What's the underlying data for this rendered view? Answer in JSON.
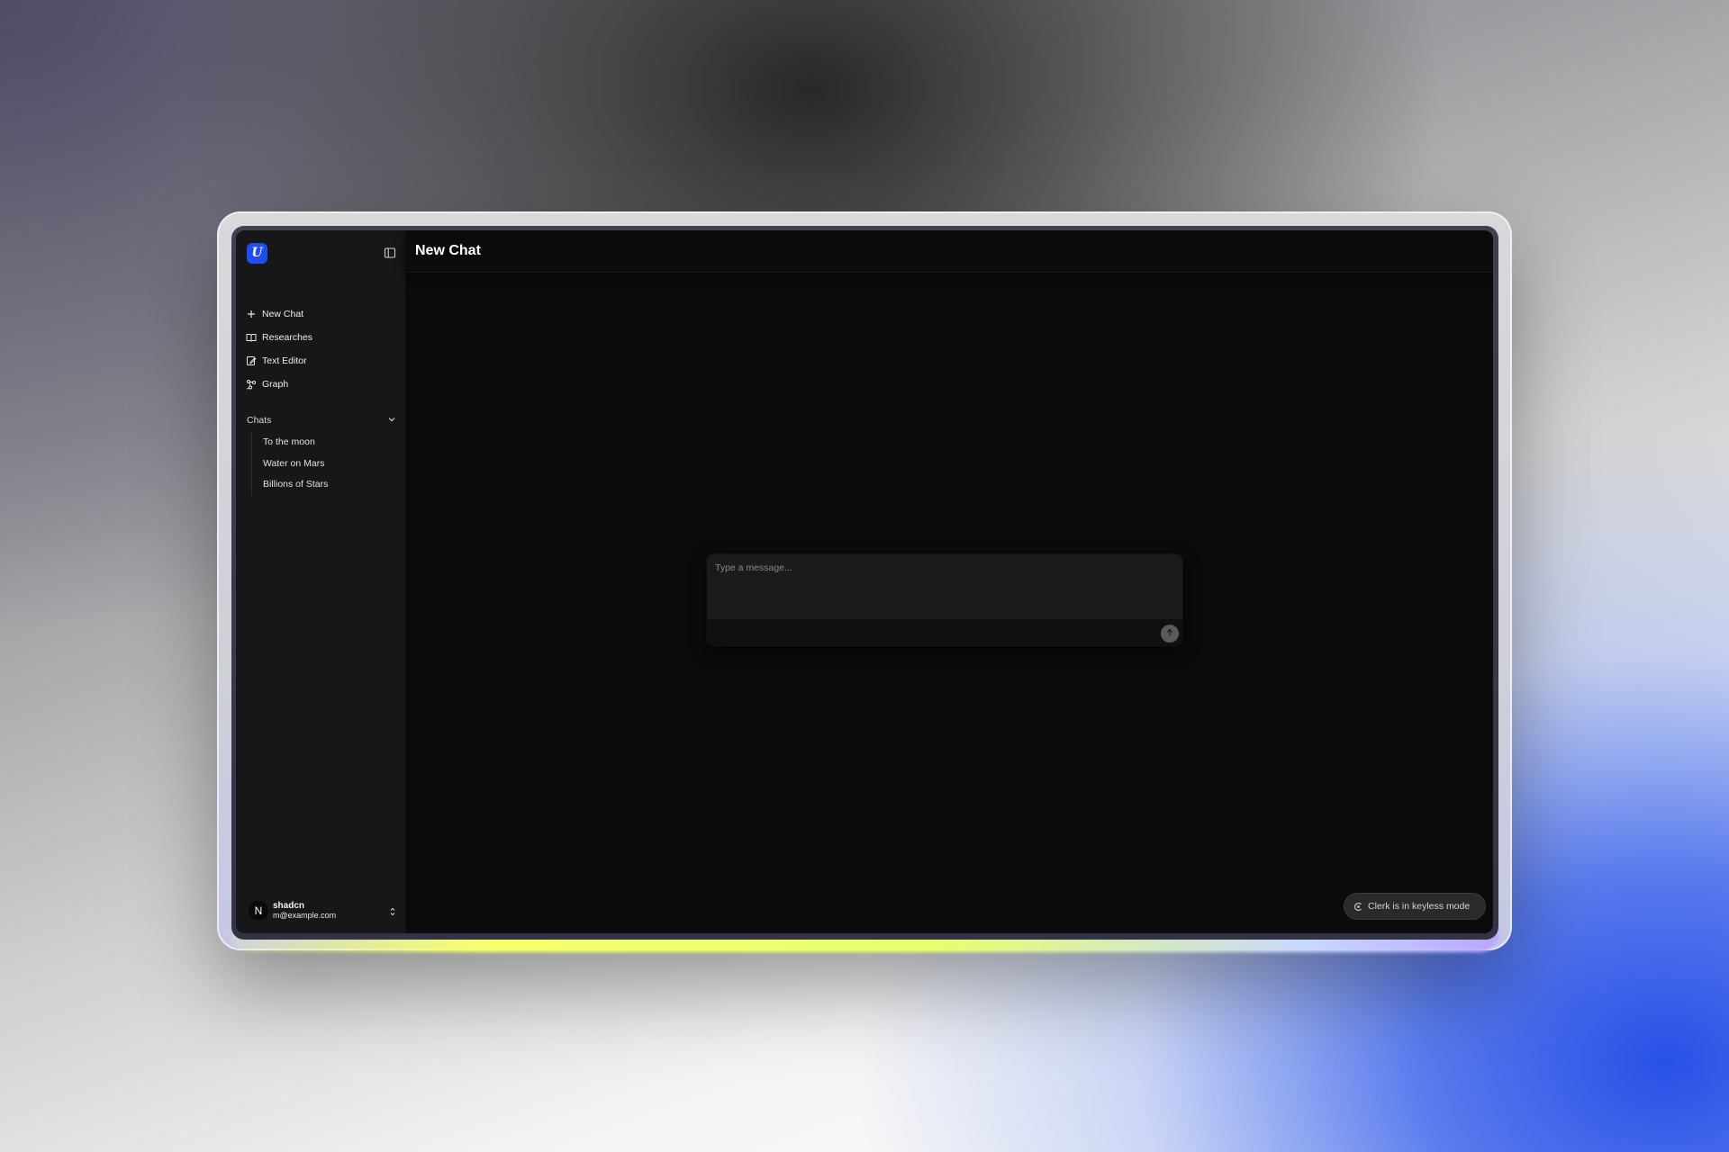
{
  "app": {
    "logo_letter": "U",
    "accent_color": "#1f4ef0"
  },
  "sidebar": {
    "toggle_icon": "sidebar-toggle-icon",
    "nav_items": [
      {
        "label": "New Chat",
        "icon": "plus-icon"
      },
      {
        "label": "Researches",
        "icon": "book-open-icon"
      },
      {
        "label": "Text Editor",
        "icon": "edit-document-icon"
      },
      {
        "label": "Graph",
        "icon": "graph-icon"
      }
    ],
    "chats": {
      "label": "Chats",
      "icon": "chevron-down-icon",
      "items": [
        {
          "label": "To the moon"
        },
        {
          "label": "Water on Mars"
        },
        {
          "label": "Billions of Stars"
        }
      ]
    },
    "user": {
      "avatar_letter": "N",
      "name": "shadcn",
      "email": "m@example.com",
      "icon": "chevrons-up-down-icon"
    }
  },
  "main": {
    "title": "New Chat",
    "composer": {
      "placeholder": "Type a message...",
      "value": "",
      "send_icon": "arrow-up-icon"
    },
    "keyless_badge": {
      "label": "Clerk is in keyless mode",
      "icon": "clerk-icon"
    }
  }
}
